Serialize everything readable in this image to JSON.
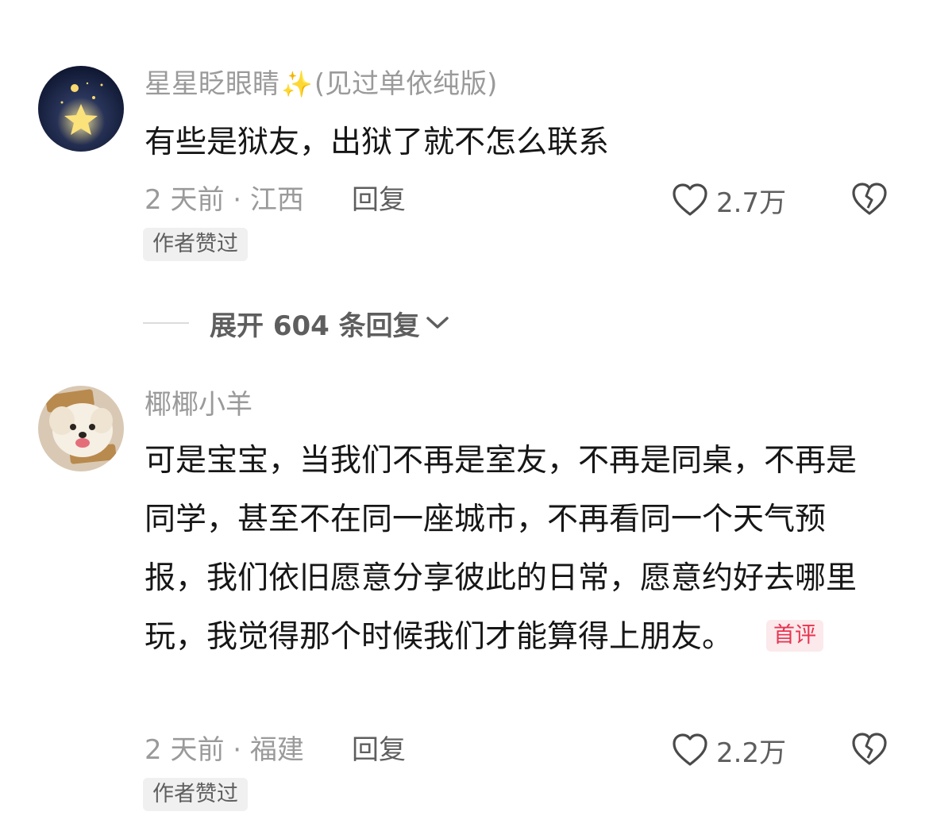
{
  "comments": [
    {
      "username": "星星眨眼睛",
      "username_suffix": "(见过单依纯版)",
      "text": "有些是狱友，出狱了就不怎么联系",
      "meta": "2 天前 · 江西",
      "reply_label": "回复",
      "likes": "2.7万",
      "author_badge": "作者赞过",
      "avatar_icon": "star-night-avatar"
    },
    {
      "username": "椰椰小羊",
      "text": "可是宝宝，当我们不再是室友，不再是同桌，不再是同学，甚至不在同一座城市，不再看同一个天气预报，我们依旧愿意分享彼此的日常，愿意约好去哪里玩，我觉得那个时候我们才能算得上朋友。",
      "first_badge": "首评",
      "meta": "2 天前 · 福建",
      "reply_label": "回复",
      "likes": "2.2万",
      "author_badge": "作者赞过",
      "avatar_icon": "puppy-avatar"
    }
  ],
  "expand_replies": "展开 604 条回复",
  "colors": {
    "secondary_text": "#9a9a9a",
    "action_text": "#5e5e5e",
    "first_badge": "#e8344f",
    "sparkle": "#f2c230"
  }
}
